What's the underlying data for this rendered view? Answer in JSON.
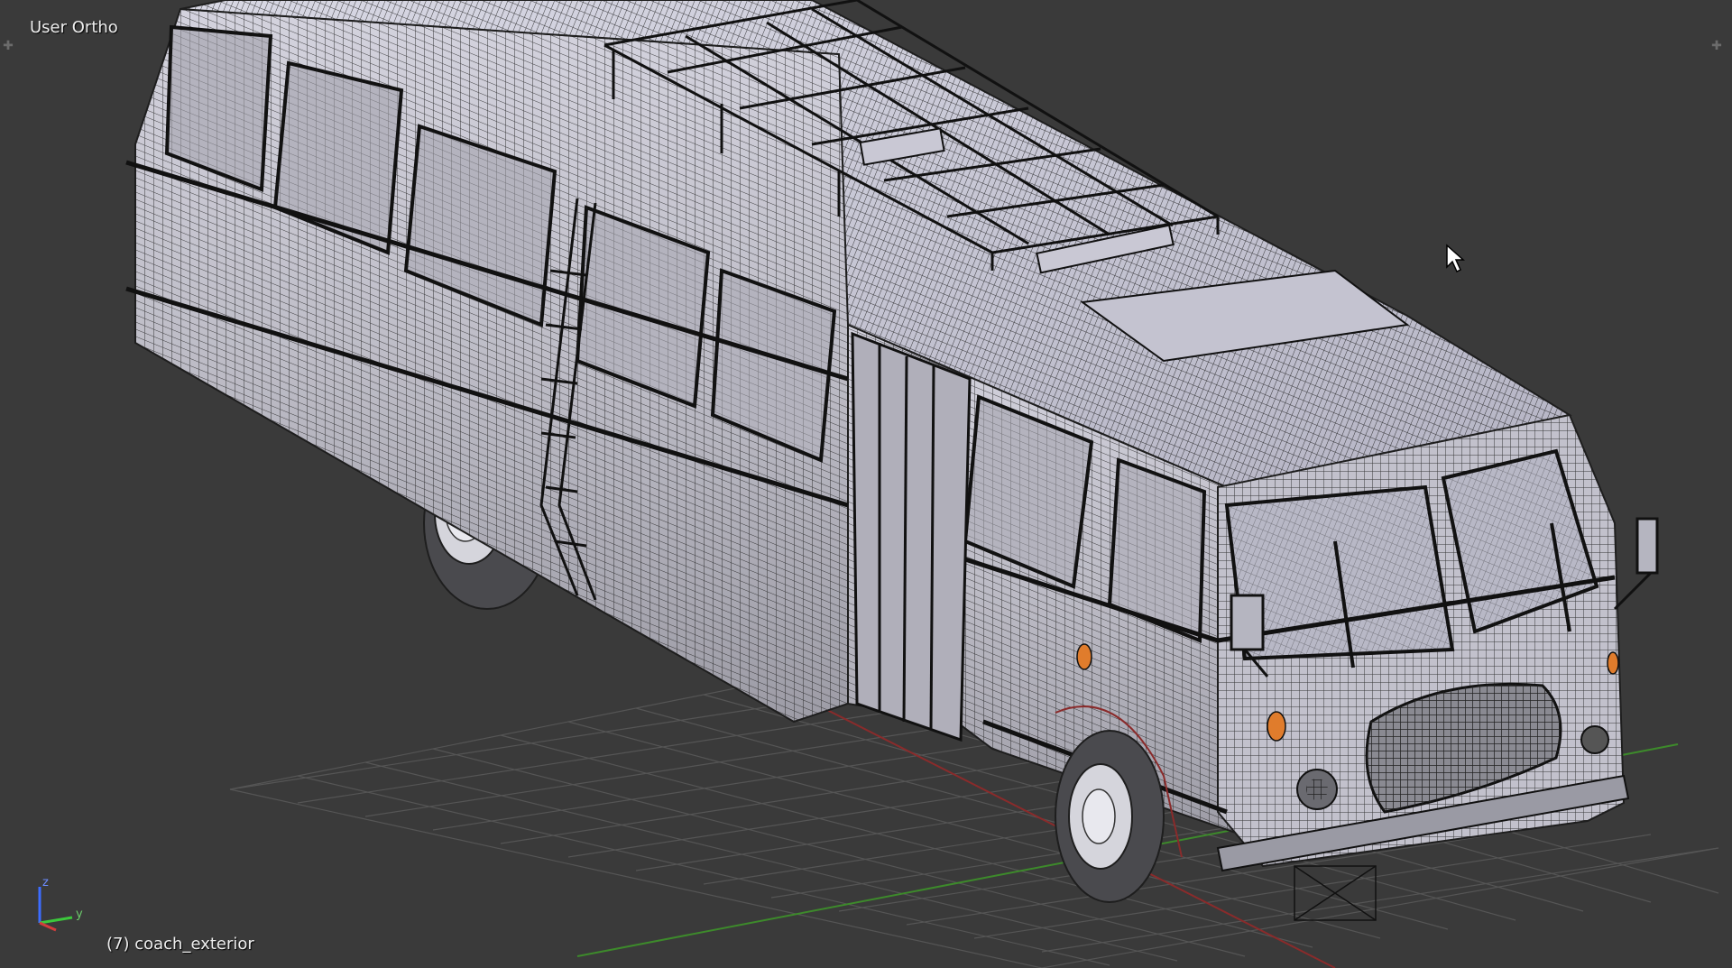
{
  "viewport": {
    "view_name": "User Ortho",
    "object_info": "(7) coach_exterior",
    "background_color": "#3a3a3a",
    "grid_color": "#555555",
    "x_axis_color": "#8a2b2b",
    "y_axis_color": "#3d8a2b",
    "mesh_color": "#c9c8d2",
    "wire_color": "#1e1e1e"
  },
  "gizmo": {
    "axis_z": "z",
    "axis_y": "y",
    "x_color": "#d23c3c",
    "y_color": "#3cc83c",
    "z_color": "#3c6cff"
  },
  "icons": {
    "corner_left": "plus-icon",
    "corner_right": "plus-icon",
    "cursor": "arrow-cursor-icon"
  }
}
